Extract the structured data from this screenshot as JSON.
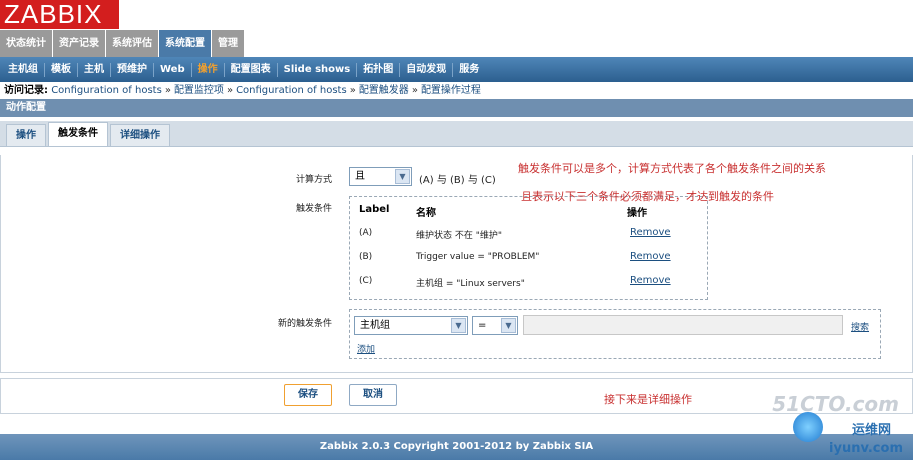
{
  "app": {
    "logo": "ZABBIX"
  },
  "main_menu": [
    {
      "label": "状态统计"
    },
    {
      "label": "资产记录"
    },
    {
      "label": "系统评估"
    },
    {
      "label": "系统配置"
    },
    {
      "label": "管理"
    }
  ],
  "sub_menu": [
    {
      "label": "主机组"
    },
    {
      "label": "模板"
    },
    {
      "label": "主机"
    },
    {
      "label": "预维护"
    },
    {
      "label": "Web"
    },
    {
      "label": "操作"
    },
    {
      "label": "配置图表"
    },
    {
      "label": "Slide shows"
    },
    {
      "label": "拓扑图"
    },
    {
      "label": "自动发现"
    },
    {
      "label": "服务"
    }
  ],
  "breadcrumb": {
    "prefix": "访问记录:",
    "items": [
      "Configuration of hosts",
      "配置监控项",
      "Configuration of hosts",
      "配置触发器",
      "配置操作过程"
    ],
    "sep": "»"
  },
  "section_title": "动作配置",
  "tabs": [
    {
      "label": "操作"
    },
    {
      "label": "触发条件"
    },
    {
      "label": "详细操作"
    }
  ],
  "form": {
    "calc_label": "计算方式",
    "calc_value": "且",
    "calc_expression": "(A) 与 (B) 与 (C)",
    "conditions_label": "触发条件",
    "cond_headers": {
      "label": "Label",
      "name": "名称",
      "action": "操作"
    },
    "conditions": [
      {
        "label": "(A)",
        "name": "维护状态 不在 \"维护\"",
        "action": "Remove"
      },
      {
        "label": "(B)",
        "name": "Trigger value = \"PROBLEM\"",
        "action": "Remove"
      },
      {
        "label": "(C)",
        "name": "主机组 = \"Linux servers\"",
        "action": "Remove"
      }
    ],
    "new_condition_label": "新的触发条件",
    "new_condition_type": "主机组",
    "new_condition_operator": "=",
    "search_link": "搜索",
    "add_link": "添加",
    "save_button": "保存",
    "cancel_button": "取消"
  },
  "notes": {
    "note1": "触发条件可以是多个，计算方式代表了各个触发条件之间的关系",
    "note2": "且表示以下三个条件必须都满足，才达到触发的条件",
    "note3": "接下来是详细操作"
  },
  "footer": {
    "copyright": "Zabbix 2.0.3 Copyright 2001-2012 by Zabbix SIA"
  },
  "watermark": {
    "line1": "51CTO.com",
    "line2": "运维网",
    "line3": "iyunv.com"
  }
}
